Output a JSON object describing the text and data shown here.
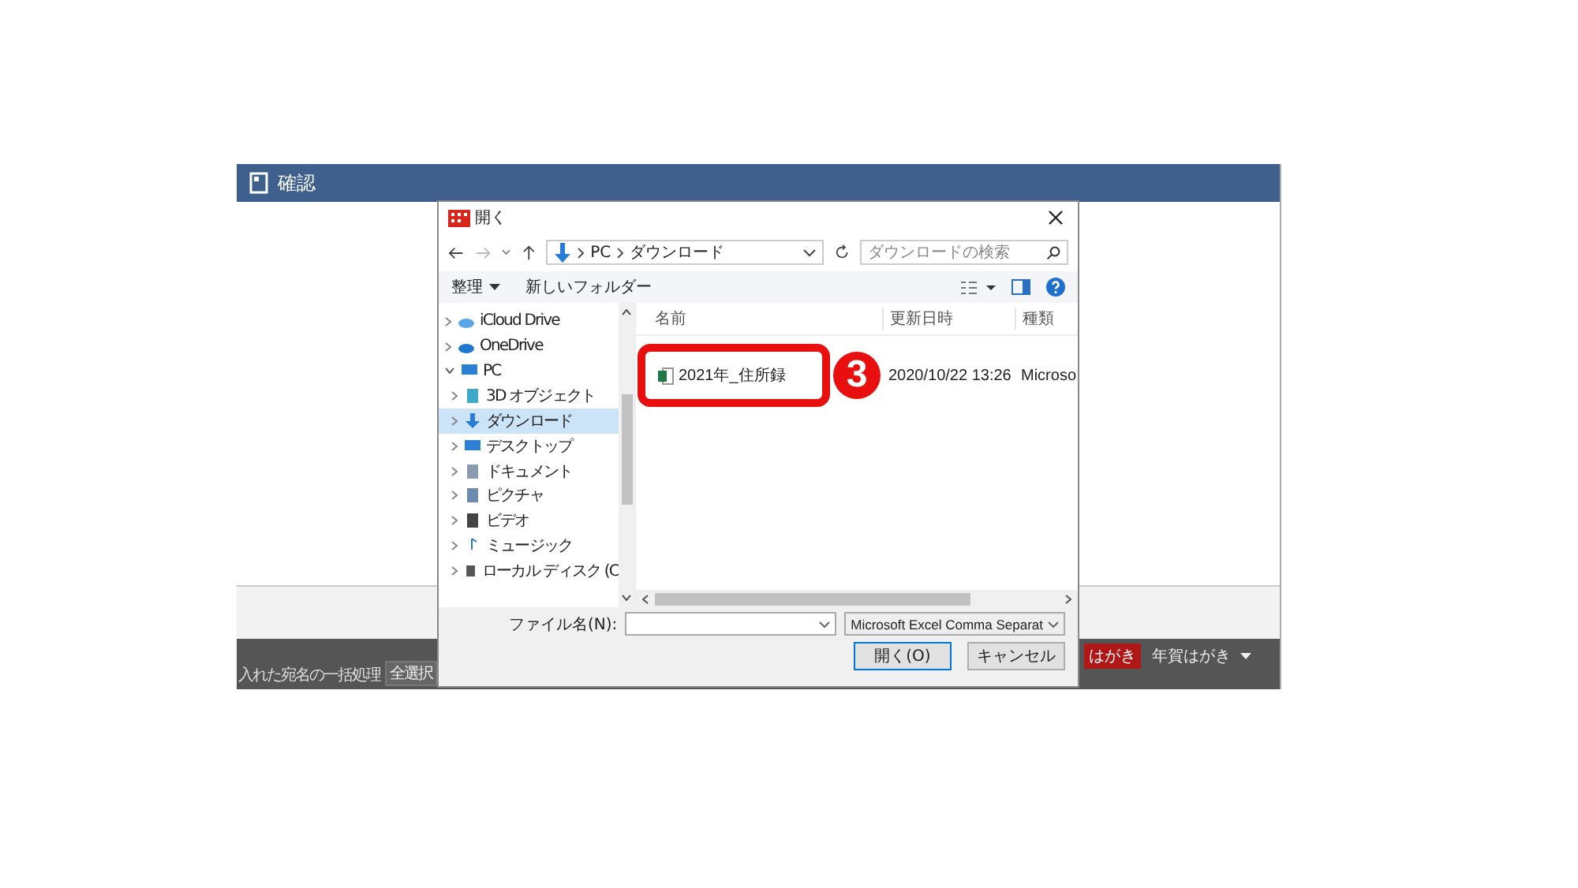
{
  "app_window": {
    "title": "確認",
    "bottom_bar": {
      "label": "入れた宛名の一括処理",
      "button": "全選択",
      "tag": "はがき",
      "dropdown": "年賀はがき"
    }
  },
  "dialog": {
    "title": "開く",
    "address": {
      "path": [
        "PC",
        "ダウンロード"
      ]
    },
    "search": {
      "placeholder": "ダウンロードの検索"
    },
    "toolbar": {
      "organize": "整理",
      "new_folder": "新しいフォルダー"
    },
    "sidebar": {
      "items": [
        {
          "label": "iCloud Drive",
          "expanded": false,
          "selected": false
        },
        {
          "label": "OneDrive",
          "expanded": false,
          "selected": false
        },
        {
          "label": "PC",
          "expanded": true,
          "selected": false,
          "children": [
            {
              "label": "3D オブジェクト",
              "expanded": false,
              "selected": false
            },
            {
              "label": "ダウンロード",
              "expanded": false,
              "selected": true
            },
            {
              "label": "デスクトップ",
              "expanded": false,
              "selected": false
            },
            {
              "label": "ドキュメント",
              "expanded": false,
              "selected": false
            },
            {
              "label": "ピクチャ",
              "expanded": false,
              "selected": false
            },
            {
              "label": "ビデオ",
              "expanded": false,
              "selected": false
            },
            {
              "label": "ミュージック",
              "expanded": false,
              "selected": false
            },
            {
              "label": "ローカル ディスク (C",
              "expanded": false,
              "selected": false
            }
          ]
        }
      ]
    },
    "file_list": {
      "columns": [
        "名前",
        "更新日時",
        "種類"
      ],
      "rows": [
        {
          "name": "2021年_住所録",
          "modified": "2020/10/22 13:26",
          "type": "Microso",
          "selected": false
        }
      ]
    },
    "file_name": {
      "label": "ファイル名(N):"
    },
    "file_type": "Microsoft Excel Comma Separat",
    "buttons": [
      "開く(O)",
      "キャンセル"
    ]
  },
  "annotation": {
    "number": "3"
  }
}
